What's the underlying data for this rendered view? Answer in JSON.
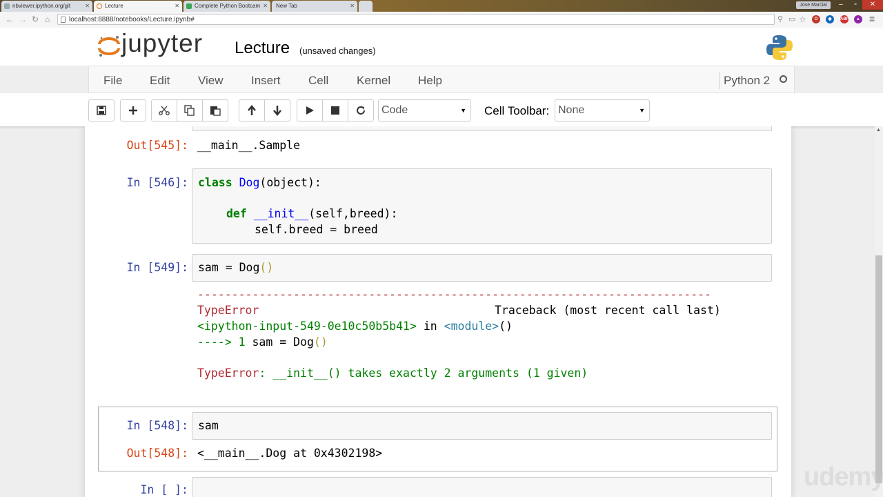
{
  "browser": {
    "tabs": [
      {
        "label": "nbviewer.ipython.org/git"
      },
      {
        "label": "Lecture"
      },
      {
        "label": "Complete Python Bootcam"
      },
      {
        "label": "New Tab"
      }
    ],
    "user": "Jose Marcial",
    "url": "localhost:8888/notebooks/Lecture.ipynb#",
    "abp_label": "ABP"
  },
  "header": {
    "logo_text": "jupyter",
    "title": "Lecture",
    "status": "(unsaved changes)"
  },
  "menu": {
    "items": [
      "File",
      "Edit",
      "View",
      "Insert",
      "Cell",
      "Kernel",
      "Help"
    ],
    "kernel": "Python 2"
  },
  "toolbar": {
    "cell_type": "Code",
    "cell_toolbar_label": "Cell Toolbar:",
    "cell_toolbar_value": "None"
  },
  "cells": {
    "out545": {
      "prompt": "Out[545]:",
      "text": "__main__.Sample"
    },
    "in546": {
      "prompt": "In [546]:",
      "line1_kw": "class",
      "line1_name": "Dog",
      "line1_rest": "(object):",
      "line2_kw": "def",
      "line2_name": "__init__",
      "line2_rest": "(self,breed):",
      "line3": "self.breed = breed"
    },
    "in549": {
      "prompt": "In [549]:",
      "code_pre": "sam = Dog",
      "code_paren": "()",
      "error_rule": "---------------------------------------------------------------------------",
      "error_type": "TypeError",
      "traceback": "Traceback (most recent call last)",
      "input_ref": "<ipython-input-549-0e10c50b5b41>",
      "in_word": "in",
      "module": "<module>",
      "module_paren": "()",
      "arrow": "---->",
      "line_no": "1",
      "line_code": "sam = Dog",
      "line_paren": "()",
      "error_label": "TypeError",
      "error_msg": ": __init__() takes exactly 2 arguments (1 given)"
    },
    "in548": {
      "prompt": "In [548]:",
      "code": "sam"
    },
    "out548": {
      "prompt": "Out[548]:",
      "text": "<__main__.Dog at 0x4302198>"
    },
    "in_empty": {
      "prompt": "In [ ]:"
    }
  },
  "watermark": "udemy"
}
